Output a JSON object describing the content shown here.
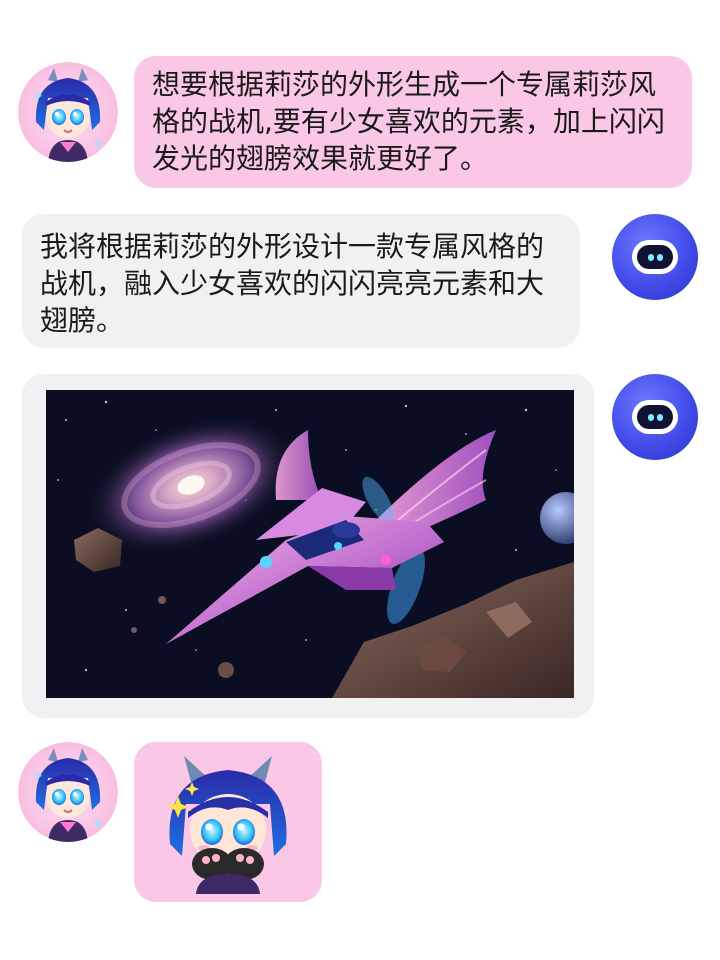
{
  "conversation": {
    "messages": [
      {
        "role": "user",
        "text": "想要根据莉莎的外形生成一个专属莉莎风格的战机,要有少女喜欢的元素，加上闪闪发光的翅膀效果就更好了。"
      },
      {
        "role": "assistant",
        "text": "我将根据莉莎的外形设计一款专属风格的战机，融入少女喜欢的闪闪亮亮元素和大翅膀。"
      },
      {
        "role": "assistant",
        "type": "image",
        "content": "pink winged starfighter in space with galaxy, planet and asteroids"
      },
      {
        "role": "user",
        "type": "image",
        "content": "chibi Lisa sticker covering mouth with paws"
      }
    ]
  },
  "colors": {
    "user_bubble": "#fac8e6",
    "bot_bubble": "#f1f1f4",
    "bot_avatar": "#3f48e6",
    "text": "#1a1a1a"
  },
  "icons": {
    "user_avatar": "lisa-avatar-icon",
    "bot_avatar": "robot-avatar-icon"
  }
}
